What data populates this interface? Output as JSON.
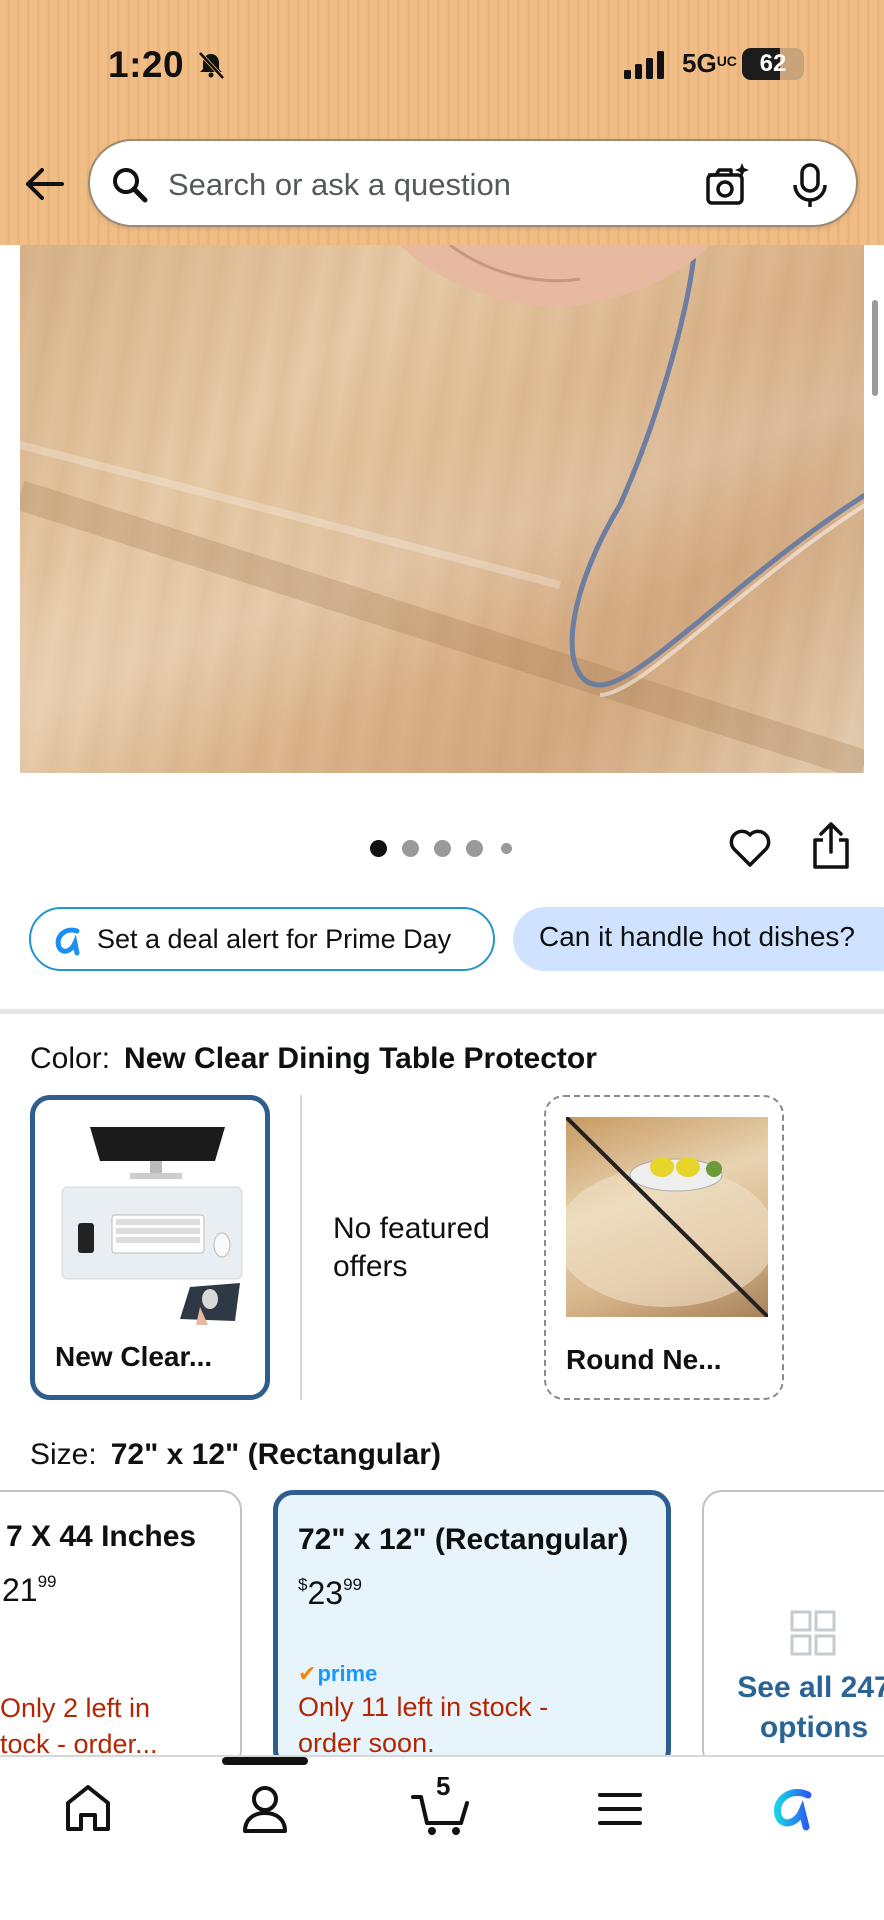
{
  "status": {
    "time": "1:20",
    "network": "5G",
    "network_sup": "UC",
    "battery": "62",
    "battery_level": 0.62
  },
  "search": {
    "placeholder": "Search or ask a question"
  },
  "gallery": {
    "total_images": 5,
    "active_index": 0
  },
  "chips": {
    "deal_alert": "Set a deal alert for Prime Day",
    "question": "Can it handle hot dishes?"
  },
  "color": {
    "label": "Color:",
    "selected": "New Clear Dining Table Protector",
    "options": [
      {
        "name": "New Clear..."
      },
      {
        "name": "No featured offers"
      },
      {
        "name": "Round Ne..."
      }
    ]
  },
  "size": {
    "label": "Size:",
    "selected": "72\" x 12\" (Rectangular)",
    "cards": [
      {
        "title": "7 X 44 Inches",
        "price_dollars": "21",
        "price_cents": "99",
        "stock": [
          "Only 2 left in",
          "tock - order..."
        ]
      },
      {
        "title": "72\" x 12\" (Rectangular)",
        "price_symbol": "$",
        "price_dollars": "23",
        "price_cents": "99",
        "prime": "prime",
        "stock": [
          "Only 11 left in stock -",
          "order soon."
        ]
      },
      {
        "see_all": [
          "See all 247",
          "options"
        ]
      }
    ]
  },
  "tabs": {
    "cart_count": "5",
    "items": [
      "home",
      "account",
      "cart",
      "menu",
      "rufus"
    ]
  },
  "colors": {
    "accent_blue": "#2e5e8e",
    "stock_red": "#b12704",
    "prime_blue": "#1a98ff",
    "header": "#f0bd86"
  }
}
